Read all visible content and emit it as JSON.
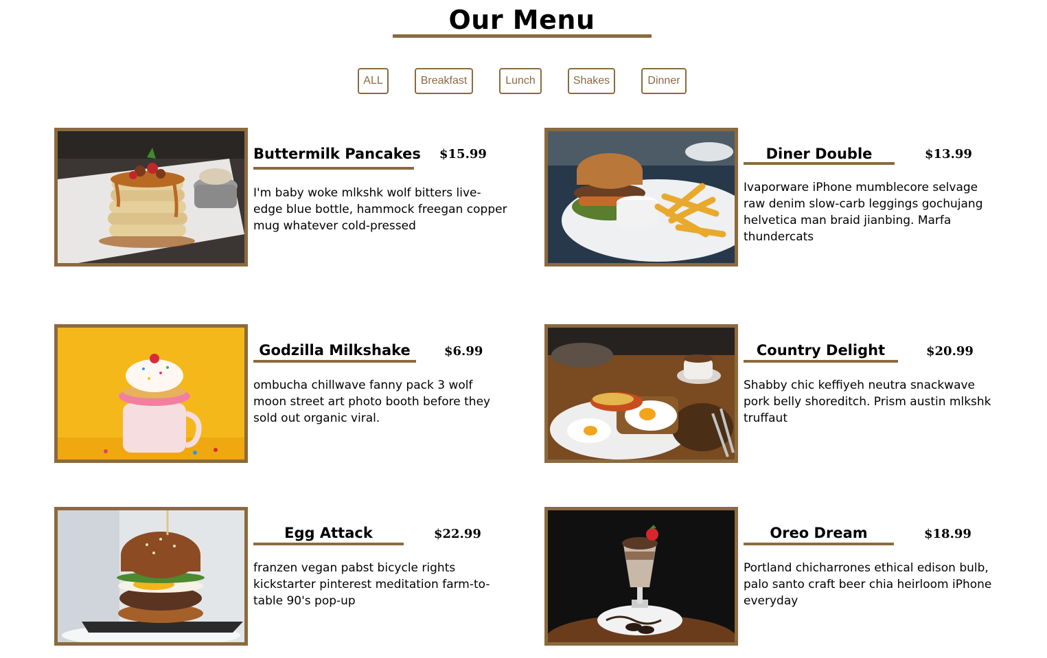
{
  "header": {
    "title": "Our Menu"
  },
  "filters": [
    {
      "label": "ALL"
    },
    {
      "label": "Breakfast"
    },
    {
      "label": "Lunch"
    },
    {
      "label": "Shakes"
    },
    {
      "label": "Dinner"
    }
  ],
  "menu_items": [
    {
      "name": "Buttermilk Pancakes",
      "price": "$15.99",
      "description": "I'm baby woke mlkshk wolf bitters live-edge blue bottle, hammock freegan copper mug whatever cold-pressed",
      "photo_icon": "pancakes-photo"
    },
    {
      "name": "Diner Double",
      "price": "$13.99",
      "description": "Ivaporware iPhone mumblecore selvage raw denim slow-carb leggings gochujang helvetica man braid jianbing. Marfa thundercats",
      "photo_icon": "burger-fries-photo"
    },
    {
      "name": "Godzilla Milkshake",
      "price": "$6.99",
      "description": "ombucha chillwave fanny pack 3 wolf moon street art photo booth before they sold out organic viral.",
      "photo_icon": "milkshake-photo"
    },
    {
      "name": "Country Delight",
      "price": "$20.99",
      "description": "Shabby chic keffiyeh neutra snackwave pork belly shoreditch. Prism austin mlkshk truffaut",
      "photo_icon": "eggs-toast-photo"
    },
    {
      "name": "Egg Attack",
      "price": "$22.99",
      "description": "franzen vegan pabst bicycle rights kickstarter pinterest meditation farm-to-table 90's pop-up",
      "photo_icon": "egg-burger-photo"
    },
    {
      "name": "Oreo Dream",
      "price": "$18.99",
      "description": "Portland chicharrones ethical edison bulb, palo santo craft beer chia heirloom iPhone everyday",
      "photo_icon": "oreo-shake-photo"
    }
  ],
  "colors": {
    "accent": "#8b6a3e",
    "text": "#000000",
    "background": "#ffffff"
  }
}
